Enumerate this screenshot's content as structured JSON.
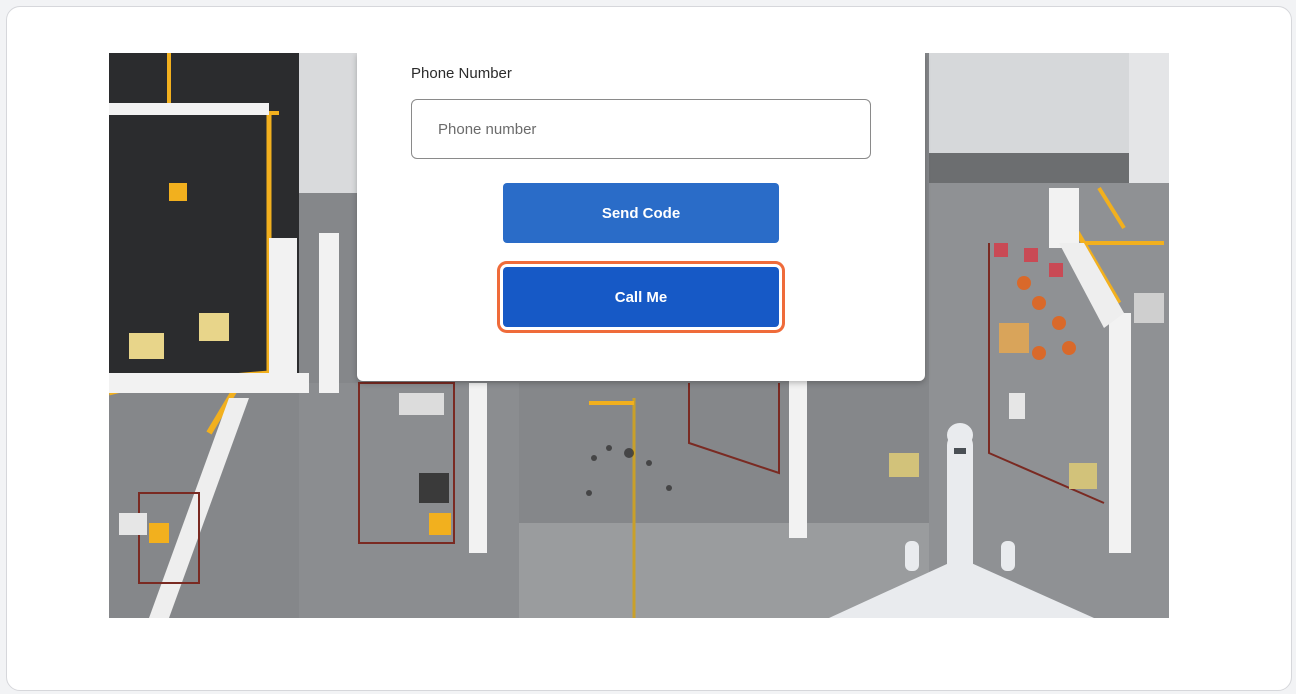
{
  "form": {
    "phone_label": "Phone Number",
    "phone_placeholder": "Phone number",
    "phone_value": "",
    "send_code_label": "Send Code",
    "call_me_label": "Call Me"
  },
  "colors": {
    "primary_button": "#2a6cc8",
    "call_button": "#1659c6",
    "highlight_outline": "#ef6b3a",
    "tarmac": "#7e8083",
    "markings_yellow": "#f2b01e"
  },
  "background": {
    "subject": "aerial view of airport apron with aircraft"
  }
}
